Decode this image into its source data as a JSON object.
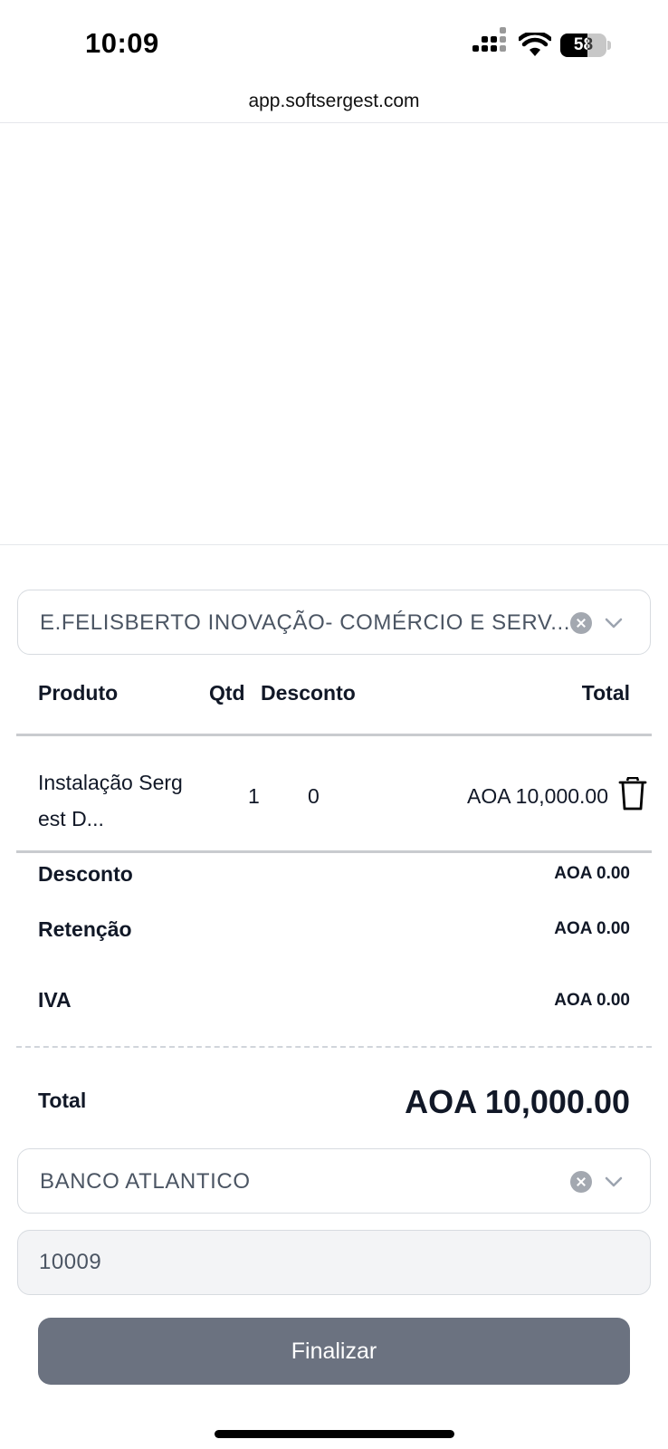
{
  "status_bar": {
    "time": "10:09",
    "battery": "58",
    "battery_level": 0.58
  },
  "browser": {
    "url": "app.softsergest.com"
  },
  "client_select": {
    "value": "E.FELISBERTO INOVAÇÃO- COMÉRCIO E SERV..."
  },
  "table": {
    "headers": {
      "product": "Produto",
      "qty": "Qtd",
      "discount": "Desconto",
      "total": "Total"
    },
    "rows": [
      {
        "product_line1": "Instalação Serg",
        "product_line2": "est D...",
        "qty": "1",
        "discount": "0",
        "total": "AOA 10,000.00"
      }
    ]
  },
  "summary": {
    "discount_label": "Desconto",
    "discount_value": "AOA 0.00",
    "retention_label": "Retenção",
    "retention_value": "AOA 0.00",
    "vat_label": "IVA",
    "vat_value": "AOA 0.00",
    "total_label": "Total",
    "total_value": "AOA 10,000.00"
  },
  "bank_select": {
    "value": "BANCO ATLANTICO"
  },
  "reference_input": {
    "value": "10009"
  },
  "finalize_button": {
    "label": "Finalizar"
  }
}
